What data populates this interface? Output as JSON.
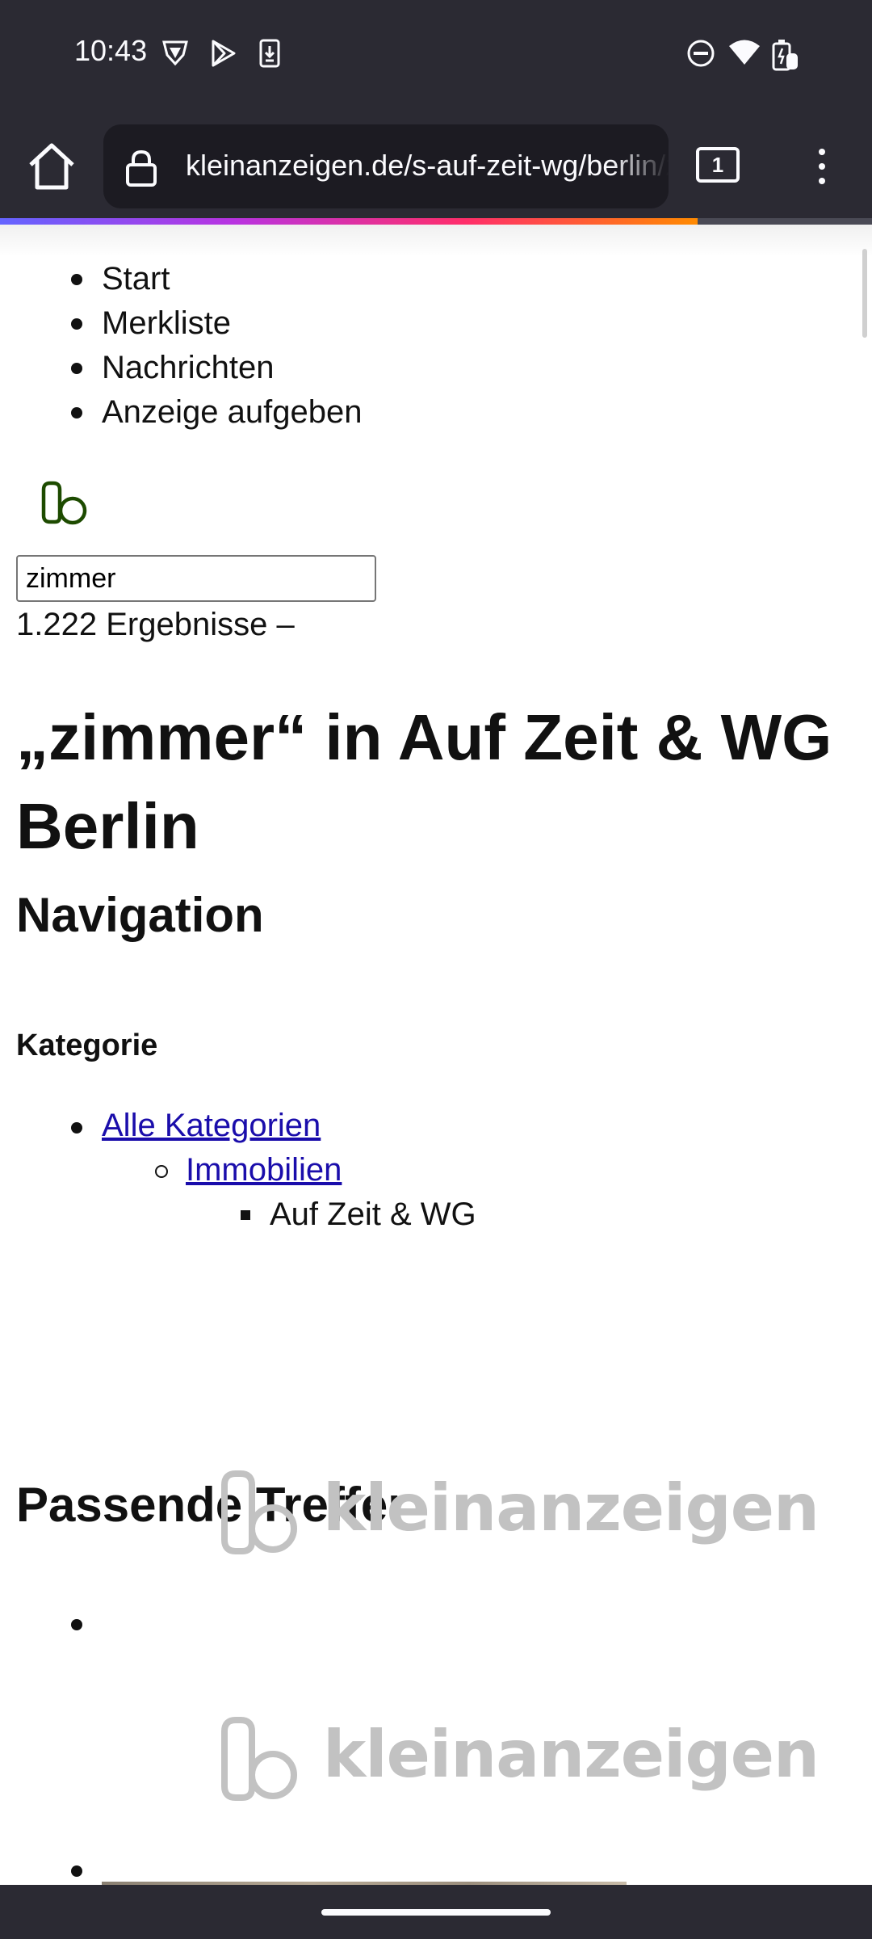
{
  "status_bar": {
    "time": "10:43",
    "icons": [
      "vpn-shield-icon",
      "play-store-icon",
      "download-icon",
      "do-not-disturb-icon",
      "wifi-icon",
      "battery-charging-icon"
    ]
  },
  "browser": {
    "url": "kleinanzeigen.de/s-auf-zeit-wg/berlin/zimmer",
    "tab_count": "1",
    "load_progress": 0.8,
    "colors": {
      "chrome": "#2b2a33",
      "url_field": "#1c1b22"
    }
  },
  "nav": {
    "items": [
      {
        "label": "Start"
      },
      {
        "label": "Merkliste"
      },
      {
        "label": "Nachrichten"
      },
      {
        "label": "Anzeige aufgeben"
      }
    ]
  },
  "search": {
    "value": "zimmer"
  },
  "results": {
    "count_text": "1.222 Ergebnisse –"
  },
  "page": {
    "title": "„zimmer“ in Auf Zeit & WG Berlin"
  },
  "navigation": {
    "heading": "Navigation",
    "category_heading": "Kategorie",
    "breadcrumb": [
      {
        "label": "Alle Kategorien",
        "link": true
      },
      {
        "label": "Immobilien",
        "link": true
      },
      {
        "label": "Auf Zeit & WG",
        "link": false
      }
    ]
  },
  "matches": {
    "heading": "Passende Treffer",
    "placeholder_text": "kleinanzeigen"
  },
  "colors": {
    "link": "#1a0dab",
    "logo_green": "#1d4b00",
    "placeholder_grey": "#c2c2c2"
  }
}
